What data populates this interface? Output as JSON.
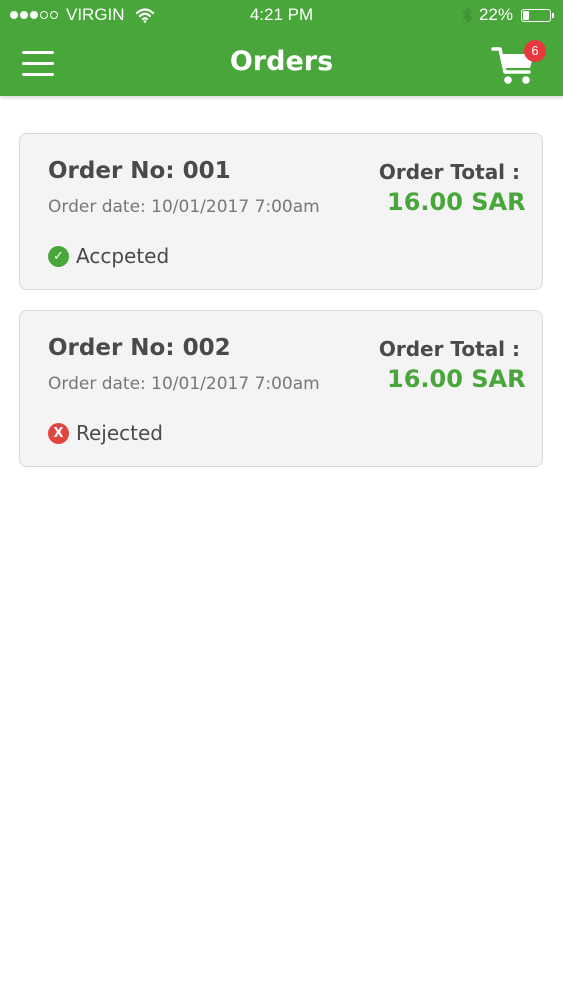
{
  "status_bar": {
    "carrier": "VIRGIN",
    "time": "4:21 PM",
    "battery_percent": "22%",
    "battery_level": 0.22,
    "signal_icon": "signal-dots-icon",
    "wifi_icon": "wifi-icon",
    "bluetooth_icon": "bluetooth-icon"
  },
  "header": {
    "title": "Orders",
    "menu_icon": "hamburger-menu-icon",
    "cart_icon": "shopping-cart-icon",
    "cart_count": "6"
  },
  "orders": [
    {
      "number": "Order No: 001",
      "date": "Order date: 10/01/2017 7:00am",
      "total_label": "Order Total :",
      "total_value": "16.00 SAR",
      "status": "Accpeted",
      "status_icon": "check-circle-icon",
      "status_symbol": "✓"
    },
    {
      "number": "Order No: 002",
      "date": "Order date: 10/01/2017 7:00am",
      "total_label": "Order Total :",
      "total_value": "16.00 SAR",
      "status": "Rejected",
      "status_icon": "x-circle-icon",
      "status_symbol": "X"
    }
  ],
  "colors": {
    "brand_green": "#48a63a",
    "badge_red": "#e8383d",
    "rejected_red": "#e0463f",
    "card_bg": "#f4f4f4"
  }
}
